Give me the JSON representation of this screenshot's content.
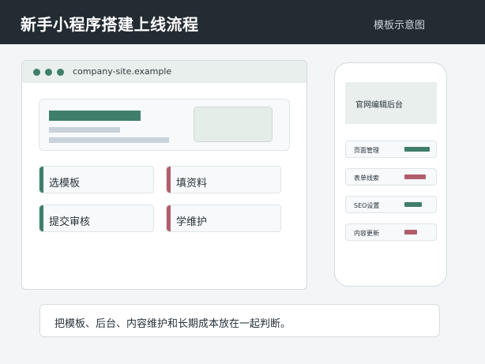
{
  "header": {
    "title": "新手小程序搭建上线流程",
    "subtitle": "模板示意图"
  },
  "browser": {
    "url": "company-site.example",
    "steps": [
      {
        "label": "选模板",
        "accent": "#3f7e6a"
      },
      {
        "label": "填资料",
        "accent": "#b35d6c"
      },
      {
        "label": "提交审核",
        "accent": "#3f7e6a"
      },
      {
        "label": "学维护",
        "accent": "#b35d6c"
      }
    ]
  },
  "phone": {
    "header": "官网编辑后台",
    "menu": [
      {
        "label": "页面管理",
        "color": "#3f7e6a",
        "fill": 0.6
      },
      {
        "label": "表单线索",
        "color": "#b35d6c",
        "fill": 0.5
      },
      {
        "label": "SEO设置",
        "color": "#3f7e6a",
        "fill": 0.4
      },
      {
        "label": "内容更新",
        "color": "#b35d6c",
        "fill": 0.3
      }
    ]
  },
  "caption": "把模板、后台、内容维护和长期成本放在一起判断。",
  "colors": {
    "header_bg": "#232b33",
    "accent_green": "#3f7e6a",
    "accent_red": "#b35d6c"
  }
}
